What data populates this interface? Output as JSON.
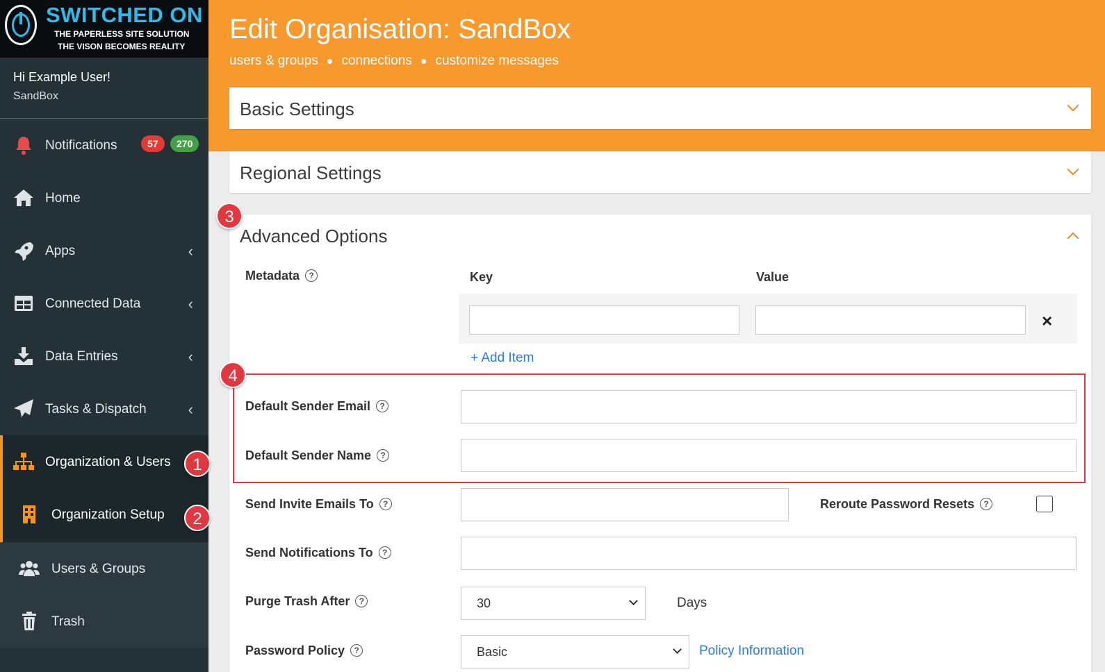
{
  "logo": {
    "brand": "SWITCHED ON",
    "tagline1": "THE PAPERLESS SITE SOLUTION",
    "tagline2": "THE VISON BECOMES REALITY"
  },
  "user": {
    "greeting": "Hi Example User!",
    "org": "SandBox"
  },
  "sidebar": {
    "items": [
      {
        "label": "Notifications",
        "icon": "bell-icon"
      },
      {
        "label": "Home",
        "icon": "home-icon"
      },
      {
        "label": "Apps",
        "icon": "rocket-icon"
      },
      {
        "label": "Connected Data",
        "icon": "table-icon"
      },
      {
        "label": "Data Entries",
        "icon": "download-icon"
      },
      {
        "label": "Tasks & Dispatch",
        "icon": "paper-plane-icon"
      },
      {
        "label": "Organization & Users",
        "icon": "sitemap-icon"
      },
      {
        "label": "Organization Setup",
        "icon": "building-icon"
      },
      {
        "label": "Users & Groups",
        "icon": "users-icon"
      },
      {
        "label": "Trash",
        "icon": "trash-icon"
      }
    ],
    "badge_red": "57",
    "badge_green": "270"
  },
  "steps": {
    "s1": "1",
    "s2": "2",
    "s3": "3",
    "s4": "4"
  },
  "header": {
    "title": "Edit Organisation: SandBox",
    "links": [
      "users & groups",
      "connections",
      "customize messages"
    ]
  },
  "panels": {
    "basic": "Basic Settings",
    "regional": "Regional Settings",
    "advanced": "Advanced Options"
  },
  "form": {
    "metadata_label": "Metadata",
    "key_header": "Key",
    "value_header": "Value",
    "remove_symbol": "×",
    "add_item": "+ Add Item",
    "sender_email_label": "Default Sender Email",
    "sender_name_label": "Default Sender Name",
    "invite_label": "Send Invite Emails To",
    "reroute_label": "Reroute Password Resets",
    "notify_label": "Send Notifications To",
    "purge_label": "Purge Trash After",
    "purge_value": "30",
    "purge_unit": "Days",
    "policy_label": "Password Policy",
    "policy_value": "Basic",
    "policy_link": "Policy Information",
    "help_symbol": "?"
  },
  "colors": {
    "accent": "#f7992d",
    "sidebar": "#243137",
    "highlight": "#e2373f",
    "link": "#2a7ddb",
    "badge_red": "#e53935",
    "badge_green": "#43a047"
  }
}
